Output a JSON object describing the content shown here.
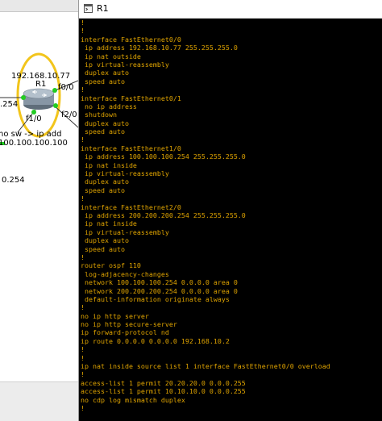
{
  "topology": {
    "router_name": "R1",
    "router_ip": "192.168.10.77",
    "interface_labels": {
      "f0_0": "f0/0",
      "f1_0": "f1/0",
      "f2_0": "f2/0"
    },
    "left_ip_fragment": ".254",
    "note_text": "no sw -> ip add",
    "network_text": "100.100.100.100",
    "lower_ip_fragment": "0.254",
    "colors": {
      "highlight_ring": "#f2c51c",
      "link_endpoint": "#22cc22",
      "router_body": "#9aa7b4"
    },
    "icons": [
      "router-icon"
    ]
  },
  "console": {
    "title": "R1",
    "app_icon": "terminal-app-icon",
    "text_color": "#e0a400",
    "background": "#000000",
    "lines": [
      "!",
      "!",
      "interface FastEthernet0/0",
      " ip address 192.168.10.77 255.255.255.0",
      " ip nat outside",
      " ip virtual-reassembly",
      " duplex auto",
      " speed auto",
      "!",
      "interface FastEthernet0/1",
      " no ip address",
      " shutdown",
      " duplex auto",
      " speed auto",
      "!",
      "interface FastEthernet1/0",
      " ip address 100.100.100.254 255.255.255.0",
      " ip nat inside",
      " ip virtual-reassembly",
      " duplex auto",
      " speed auto",
      "!",
      "interface FastEthernet2/0",
      " ip address 200.200.200.254 255.255.255.0",
      " ip nat inside",
      " ip virtual-reassembly",
      " duplex auto",
      " speed auto",
      "!",
      "router ospf 110",
      " log-adjacency-changes",
      " network 100.100.100.254 0.0.0.0 area 0",
      " network 200.200.200.254 0.0.0.0 area 0",
      " default-information originate always",
      "!",
      "no ip http server",
      "no ip http secure-server",
      "ip forward-protocol nd",
      "ip route 0.0.0.0 0.0.0.0 192.168.10.2",
      "!",
      "!",
      "ip nat inside source list 1 interface FastEthernet0/0 overload",
      "!",
      "access-list 1 permit 20.20.20.0 0.0.0.255",
      "access-list 1 permit 10.10.10.0 0.0.0.255",
      "no cdp log mismatch duplex",
      "!"
    ]
  }
}
